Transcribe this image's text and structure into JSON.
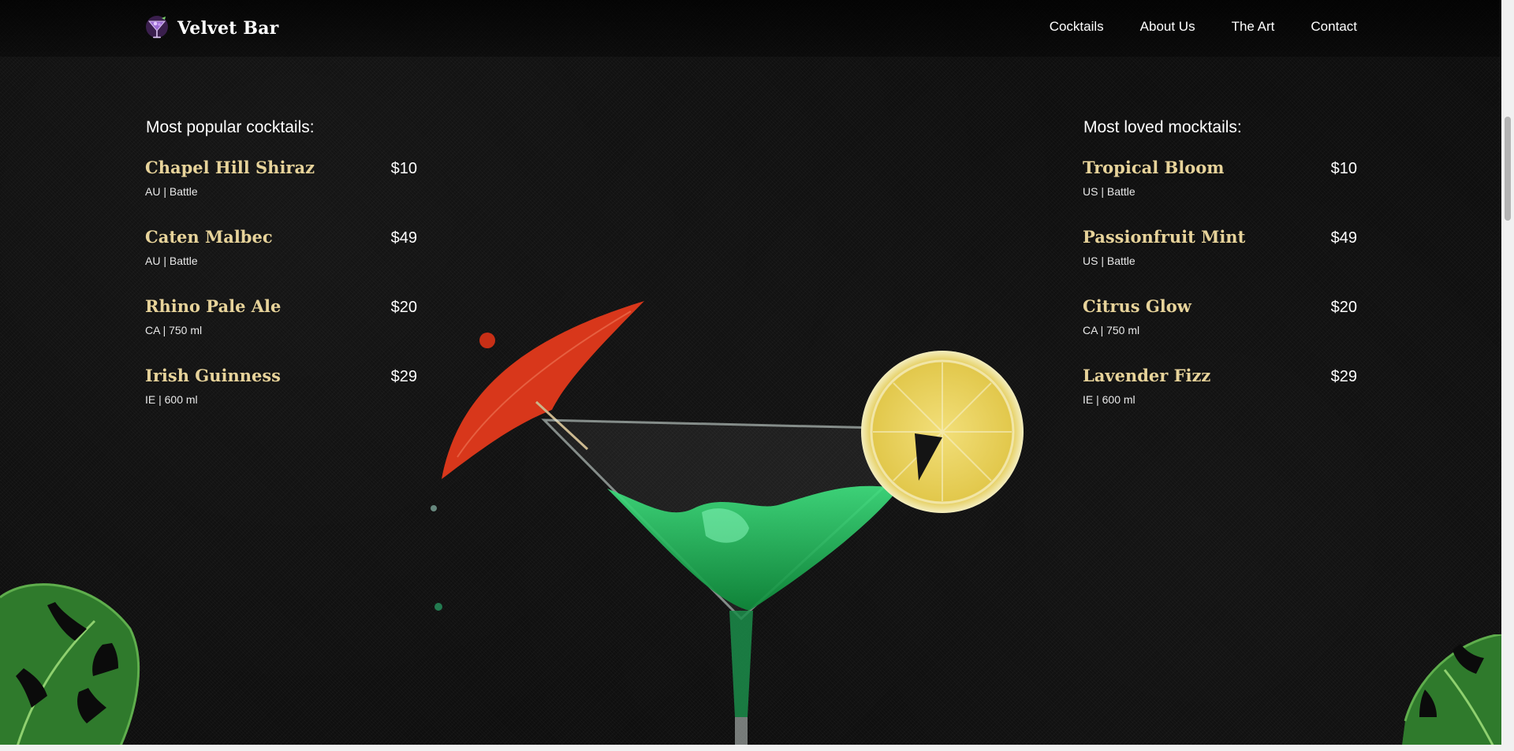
{
  "brand": {
    "name": "Velvet Bar",
    "logo_icon": "cocktail-glass-icon"
  },
  "nav": {
    "links": [
      {
        "label": "Cocktails"
      },
      {
        "label": "About Us"
      },
      {
        "label": "The Art"
      },
      {
        "label": "Contact"
      }
    ]
  },
  "cocktails": {
    "heading": "Most popular cocktails:",
    "items": [
      {
        "name": "Chapel Hill Shiraz",
        "price": "$10",
        "meta": "AU | Battle"
      },
      {
        "name": "Caten Malbec",
        "price": "$49",
        "meta": "AU | Battle"
      },
      {
        "name": "Rhino Pale Ale",
        "price": "$20",
        "meta": "CA | 750 ml"
      },
      {
        "name": "Irish Guinness",
        "price": "$29",
        "meta": "IE | 600 ml"
      }
    ]
  },
  "mocktails": {
    "heading": "Most loved mocktails:",
    "items": [
      {
        "name": "Tropical Bloom",
        "price": "$10",
        "meta": "US | Battle"
      },
      {
        "name": "Passionfruit Mint",
        "price": "$49",
        "meta": "US | Battle"
      },
      {
        "name": "Citrus Glow",
        "price": "$20",
        "meta": "CA | 750 ml"
      },
      {
        "name": "Lavender Fizz",
        "price": "$29",
        "meta": "IE | 600 ml"
      }
    ]
  },
  "colors": {
    "item_name": "#e7d39a",
    "background": "#0b0b0b",
    "text": "#ffffff"
  }
}
